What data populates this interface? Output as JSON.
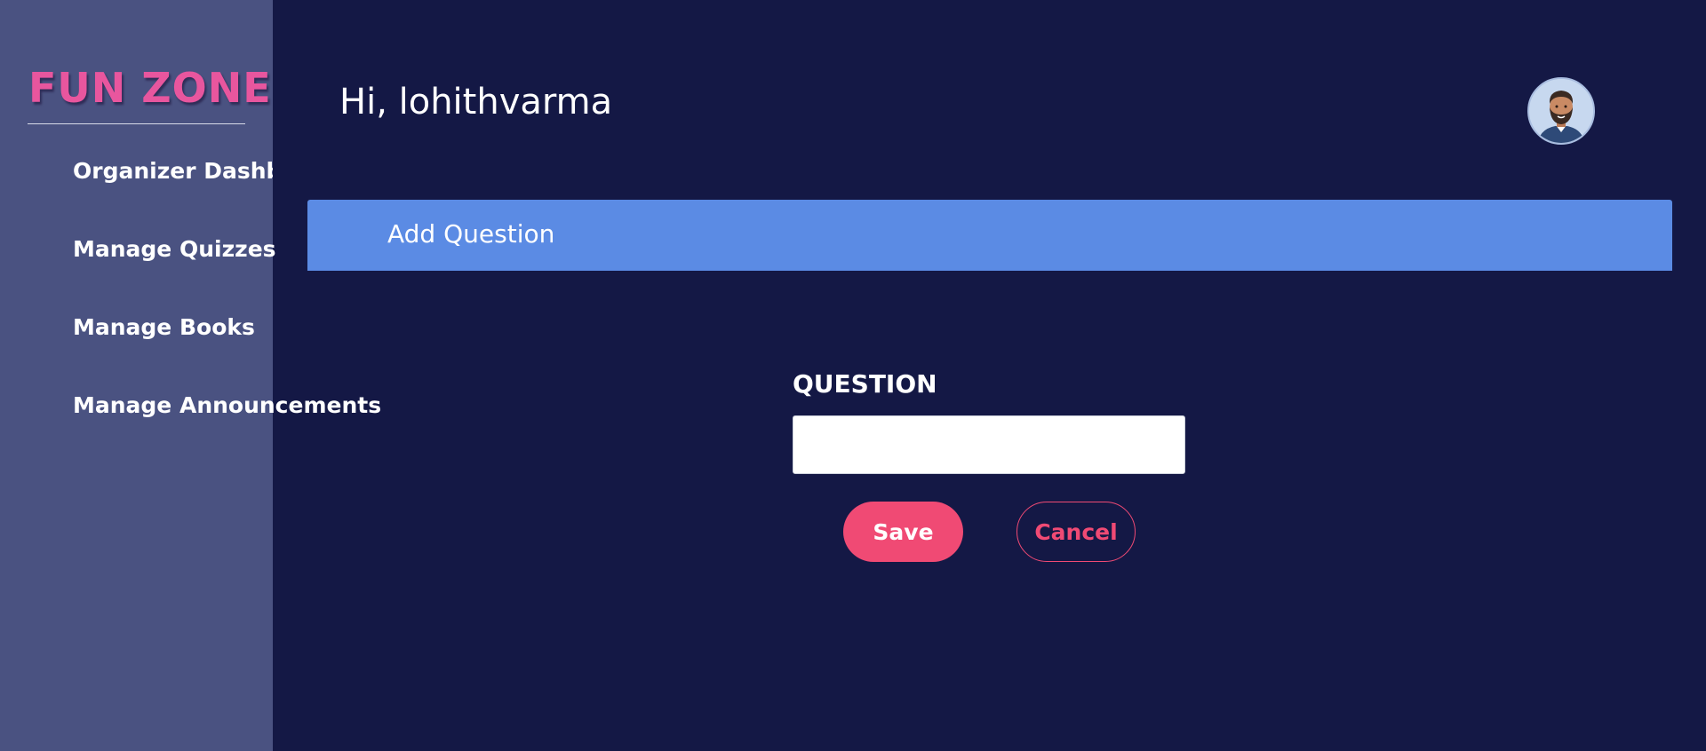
{
  "app": {
    "logo": "FUN ZONE",
    "greeting": "Hi, lohithvarma",
    "colors": {
      "sidebar_bg": "#4a5281",
      "main_bg": "#141845",
      "banner_bg": "#5b8be4",
      "accent": "#f04a74",
      "logo": "#e8569e"
    }
  },
  "sidebar": {
    "items": [
      {
        "label": "Organizer Dashboard"
      },
      {
        "label": "Manage Quizzes"
      },
      {
        "label": "Manage Books"
      },
      {
        "label": "Manage Announcements"
      }
    ]
  },
  "header": {
    "avatar_icon": "bearded-man-avatar-icon"
  },
  "banner": {
    "title": "Add Question"
  },
  "form": {
    "question_label": "QUESTION",
    "question_value": "",
    "save_label": "Save",
    "cancel_label": "Cancel"
  }
}
